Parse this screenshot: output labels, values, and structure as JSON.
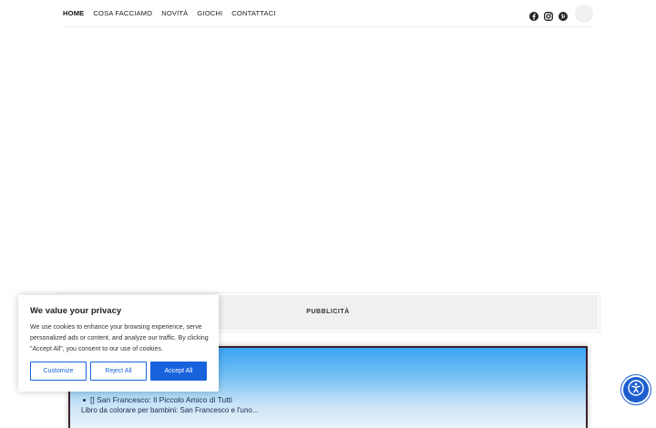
{
  "nav": {
    "items": [
      {
        "label": "HOME",
        "active": true
      },
      {
        "label": "COSA FACCIAMO",
        "active": false
      },
      {
        "label": "NOVITÀ",
        "active": false
      },
      {
        "label": "GIOCHI",
        "active": false
      },
      {
        "label": "CONTATTACI",
        "active": false
      }
    ]
  },
  "social": {
    "icons": [
      "facebook-icon",
      "instagram-icon",
      "pinterest-icon"
    ],
    "search_icon": "search-icon"
  },
  "ad": {
    "label": "PUBBLICITÀ"
  },
  "card": {
    "item_title": "[] San Francesco: Il Piccolo Amico di Tutti",
    "excerpt": "Libro da colorare per bambini: San Francesco e l'uno..."
  },
  "cookie": {
    "title": "We value your privacy",
    "body": "We use cookies to enhance your browsing experience, serve personalized ads or content, and analyze our traffic. By clicking \"Accept All\", you consent to our use of cookies.",
    "customize_label": "Customize",
    "reject_label": "Reject All",
    "accept_label": "Accept All"
  },
  "accessibility": {
    "icon": "accessibility-icon"
  },
  "colors": {
    "accent": "#1863dc",
    "a11y": "#1c5ed0",
    "card_border": "#3b1f2b"
  }
}
